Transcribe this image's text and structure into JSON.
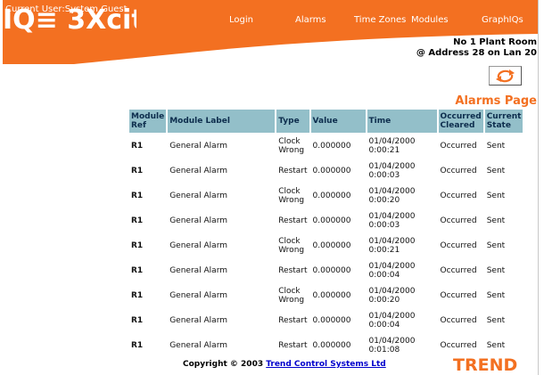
{
  "colors": {
    "accent": "#f37021",
    "header_orange": "#f37021",
    "table_header": "#93bfc9",
    "link": "#0000cc"
  },
  "header": {
    "current_user": "Current User:System Guest",
    "logo_text": "IQ≡ 3Xcite",
    "nav": {
      "login": "Login",
      "alarms": "Alarms",
      "time_zones": "Time Zones",
      "modules": "Modules",
      "graphiqs": "GraphIQs"
    }
  },
  "site": {
    "name": "No 1 Plant Room",
    "address": "@ Address 28 on Lan 20"
  },
  "refresh_icon": "refresh-icon",
  "page_title": "Alarms Page",
  "table": {
    "headers": [
      "Module Ref",
      "Module Label",
      "Type",
      "Value",
      "Time",
      "Occurred Cleared",
      "Current State"
    ],
    "rows": [
      {
        "ref": "R1",
        "label": "General Alarm",
        "type": "Clock Wrong",
        "value": "0.000000",
        "time": "01/04/2000 0:00:21",
        "occurred": "Occurred",
        "state": "Sent"
      },
      {
        "ref": "R1",
        "label": "General Alarm",
        "type": "Restart",
        "value": "0.000000",
        "time": "01/04/2000 0:00:03",
        "occurred": "Occurred",
        "state": "Sent"
      },
      {
        "ref": "R1",
        "label": "General Alarm",
        "type": "Clock Wrong",
        "value": "0.000000",
        "time": "01/04/2000 0:00:20",
        "occurred": "Occurred",
        "state": "Sent"
      },
      {
        "ref": "R1",
        "label": "General Alarm",
        "type": "Restart",
        "value": "0.000000",
        "time": "01/04/2000 0:00:03",
        "occurred": "Occurred",
        "state": "Sent"
      },
      {
        "ref": "R1",
        "label": "General Alarm",
        "type": "Clock Wrong",
        "value": "0.000000",
        "time": "01/04/2000 0:00:21",
        "occurred": "Occurred",
        "state": "Sent"
      },
      {
        "ref": "R1",
        "label": "General Alarm",
        "type": "Restart",
        "value": "0.000000",
        "time": "01/04/2000 0:00:04",
        "occurred": "Occurred",
        "state": "Sent"
      },
      {
        "ref": "R1",
        "label": "General Alarm",
        "type": "Clock Wrong",
        "value": "0.000000",
        "time": "01/04/2000 0:00:20",
        "occurred": "Occurred",
        "state": "Sent"
      },
      {
        "ref": "R1",
        "label": "General Alarm",
        "type": "Restart",
        "value": "0.000000",
        "time": "01/04/2000 0:00:04",
        "occurred": "Occurred",
        "state": "Sent"
      },
      {
        "ref": "R1",
        "label": "General Alarm",
        "type": "Restart",
        "value": "0.000000",
        "time": "01/04/2000 0:01:08",
        "occurred": "Occurred",
        "state": "Sent"
      }
    ]
  },
  "footer": {
    "copyright": "Copyright © 2003 ",
    "company_link": "Trend Control Systems Ltd",
    "brand_logo_text": "TREND"
  }
}
